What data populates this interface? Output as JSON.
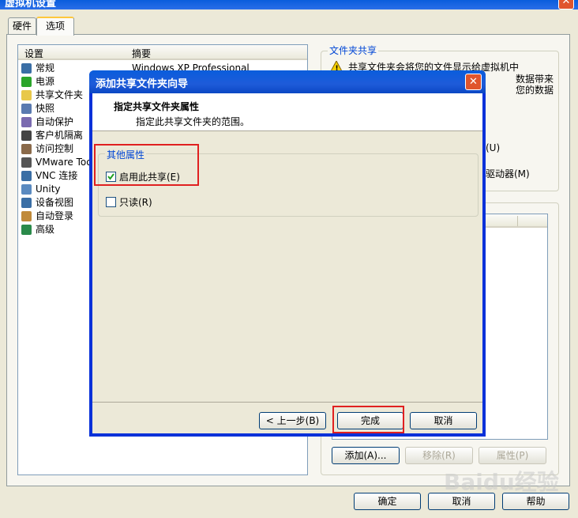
{
  "window": {
    "title": "虚拟机设置",
    "close_glyph": "✕"
  },
  "tabs": [
    {
      "label": "硬件"
    },
    {
      "label": "选项"
    }
  ],
  "settings_list": {
    "col_setting": "设置",
    "col_summary": "摘要",
    "items": [
      {
        "label": "常规",
        "summary": "Windows XP Professional",
        "icon": "general-icon",
        "color": "#3a6ea5"
      },
      {
        "label": "电源",
        "icon": "power-icon",
        "color": "#2ba52b"
      },
      {
        "label": "共享文件夹",
        "icon": "shared-folder-icon",
        "color": "#e8c84a"
      },
      {
        "label": "快照",
        "icon": "snapshot-icon",
        "color": "#5a7ab0"
      },
      {
        "label": "自动保护",
        "icon": "autoprotect-icon",
        "color": "#7a6ab0"
      },
      {
        "label": "客户机隔离",
        "icon": "lock-icon",
        "color": "#444444"
      },
      {
        "label": "访问控制",
        "icon": "access-control-icon",
        "color": "#8a6a4a"
      },
      {
        "label": "VMware Too",
        "icon": "vmware-tools-icon",
        "color": "#555555"
      },
      {
        "label": "VNC 连接",
        "icon": "vnc-icon",
        "color": "#3a6ea5"
      },
      {
        "label": "Unity",
        "icon": "unity-icon",
        "color": "#5a8ac0"
      },
      {
        "label": "设备视图",
        "icon": "device-view-icon",
        "color": "#3a6ea5"
      },
      {
        "label": "自动登录",
        "icon": "autologin-icon",
        "color": "#c08a3a"
      },
      {
        "label": "高级",
        "icon": "advanced-icon",
        "color": "#2a8a4a"
      }
    ]
  },
  "share_group": {
    "title": "文件夹共享",
    "warning_text": [
      "共享文件夹会将您的文件显示给虚拟机中",
      "数据带来",
      "您的数据"
    ],
    "option_u_suffix": "(U)",
    "option_m_suffix": "驱动器(M)"
  },
  "folder_buttons": {
    "add": "添加(A)...",
    "remove": "移除(R)",
    "properties": "属性(P)"
  },
  "footer_buttons": {
    "ok": "确定",
    "cancel": "取消",
    "help": "帮助"
  },
  "dialog": {
    "title": "添加共享文件夹向导",
    "heading": "指定共享文件夹属性",
    "subheading": "指定此共享文件夹的范围。",
    "group_title": "其他属性",
    "enable_share": {
      "label": "启用此共享(E)",
      "checked": true
    },
    "read_only": {
      "label": "只读(R)",
      "checked": false
    },
    "back": "< 上一步(B)",
    "finish": "完成",
    "cancel": "取消"
  },
  "watermark": "Baidu经验"
}
